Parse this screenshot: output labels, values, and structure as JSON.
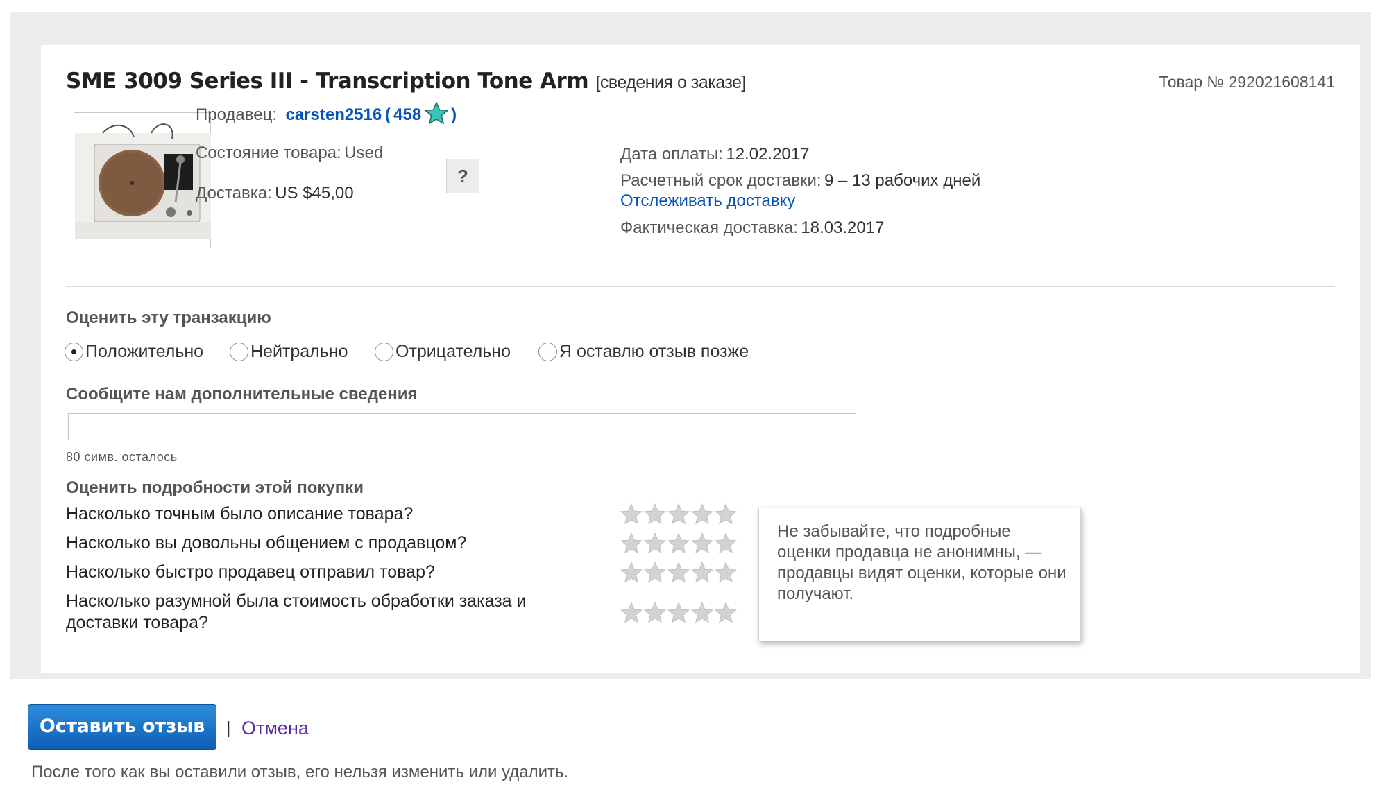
{
  "order": {
    "title": "SME 3009 Series III - Transcription Tone Arm",
    "bracket_open": "[",
    "details_link": "сведения о заказе",
    "bracket_close": "]",
    "item_number": "Товар № 292021608141",
    "thumbnail_alt": "turntable-photo"
  },
  "seller": {
    "label": "Продавец:",
    "name": "carsten2516",
    "paren_open": "(",
    "feedback_score": "458",
    "paren_close": ")",
    "star_icon": "turquoise-star-icon"
  },
  "condition": {
    "label": "Состояние товара:",
    "value": "Used",
    "help": "?"
  },
  "shipping": {
    "label": "Доставка:",
    "value": "US $45,00"
  },
  "payment": {
    "label": "Дата оплаты:",
    "value": "12.02.2017"
  },
  "estimated_delivery": {
    "label": "Расчетный срок доставки:",
    "value": "9 – 13 рабочих дней"
  },
  "track_link": "Отслеживать доставку",
  "actual_delivery": {
    "label": "Фактическая доставка:",
    "value": "18.03.2017"
  },
  "rating": {
    "heading": "Оценить эту транзакцию",
    "options": [
      {
        "label": "Положительно",
        "checked": true
      },
      {
        "label": "Нейтрально",
        "checked": false
      },
      {
        "label": "Отрицательно",
        "checked": false
      },
      {
        "label": "Я оставлю отзыв позже",
        "checked": false
      }
    ]
  },
  "comment": {
    "heading": "Сообщите нам дополнительные сведения",
    "value": "",
    "placeholder": "",
    "counter": "80 симв. осталось"
  },
  "details": {
    "heading": "Оценить подробности этой покупки",
    "questions": [
      {
        "text": "Насколько точным было описание товара?",
        "stars": 0
      },
      {
        "text": "Насколько вы довольны общением с продавцом?",
        "stars": 0
      },
      {
        "text": "Насколько быстро продавец отправил товар?",
        "stars": 0
      },
      {
        "line1": "Насколько разумной была стоимость обработки заказа и",
        "line2": "доставки товара?",
        "stars": 0
      }
    ],
    "tooltip": "Не забывайте, что подробные оценки продавца не анонимны, — продавцы видят оценки, которые они получают."
  },
  "actions": {
    "submit": "Оставить отзыв",
    "separator": "|",
    "cancel": "Отмена",
    "note": "После того как вы оставили отзыв, его нельзя изменить или удалить."
  },
  "colors": {
    "link": "#0654ba",
    "primary_button": "#1a70c8",
    "cancel_link": "#5a2aa0",
    "star_empty": "#d3d3d3",
    "seller_star": "#3cc4b4"
  }
}
